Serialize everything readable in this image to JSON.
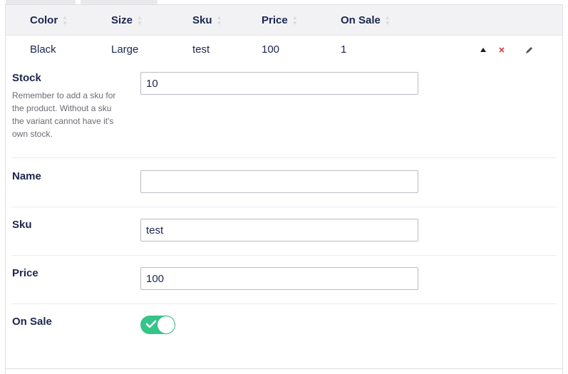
{
  "table": {
    "headers": [
      {
        "label": "Color"
      },
      {
        "label": "Size"
      },
      {
        "label": "Sku"
      },
      {
        "label": "Price"
      },
      {
        "label": "On Sale"
      }
    ],
    "row": {
      "color": "Black",
      "size": "Large",
      "sku": "test",
      "price": "100",
      "on_sale": "1"
    }
  },
  "form": {
    "stock": {
      "label": "Stock",
      "help": "Remember to add a sku for the product. Without a sku the variant cannot have it's own stock.",
      "value": "10"
    },
    "name": {
      "label": "Name",
      "value": ""
    },
    "sku": {
      "label": "Sku",
      "value": "test"
    },
    "price": {
      "label": "Price",
      "value": "100"
    },
    "on_sale": {
      "label": "On Sale",
      "checked": true
    }
  },
  "colors": {
    "accent_green": "#35c48a",
    "delete_red": "#d0464b",
    "text_navy": "#1b264f"
  },
  "icons": {
    "sort": "sort-icon",
    "move_up": "triangle-up-icon",
    "delete": "close-icon",
    "edit": "pencil-icon",
    "check": "check-icon"
  }
}
